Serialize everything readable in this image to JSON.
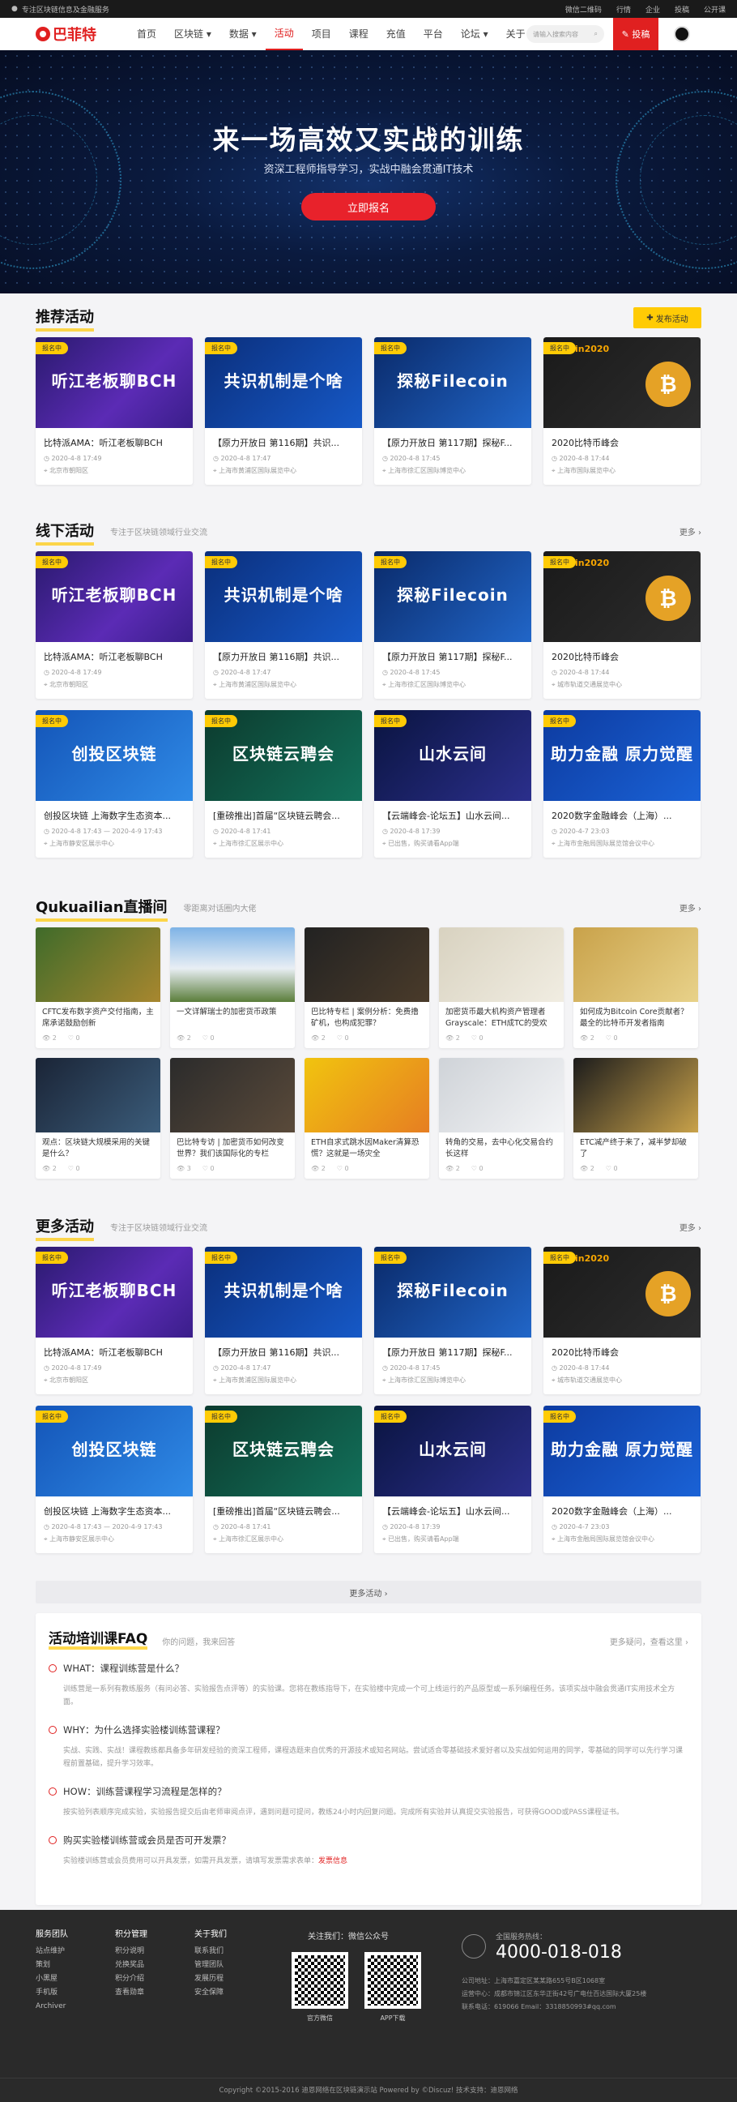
{
  "topbar": {
    "left": "专注区块链信息及金融服务",
    "links": [
      "微信二维码",
      "行情",
      "企业",
      "投稿",
      "公开课"
    ]
  },
  "nav": {
    "logo": "巴菲特",
    "menu": [
      "首页",
      "区块链 ▾",
      "数据 ▾",
      "活动",
      "项目",
      "课程",
      "充值",
      "平台",
      "论坛 ▾",
      "关于"
    ],
    "search_placeholder": "请输入搜索内容",
    "contribute": "投稿"
  },
  "hero": {
    "title": "来一场高效又实战的训练",
    "subtitle": "资深工程师指导学习，实战中融会贯通IT技术",
    "button": "立即报名"
  },
  "recommend": {
    "title": "推荐活动",
    "publish": "发布活动",
    "cards": [
      {
        "badge": "报名中",
        "img": "听江老板聊BCH",
        "title": "比特派AMA：听江老板聊BCH",
        "date": "2020-4-8 17:49",
        "place": "北京市朝阳区"
      },
      {
        "badge": "报名中",
        "img": "共识机制是个啥",
        "title": "【原力开放日 第116期】共识...",
        "date": "2020-4-8 17:47",
        "place": "上海市黄浦区国际展览中心"
      },
      {
        "badge": "报名中",
        "img": "探秘Filecoin",
        "title": "【原力开放日 第117期】探秘F...",
        "date": "2020-4-8 17:45",
        "place": "上海市徐汇区国际博览中心"
      },
      {
        "badge": "报名中",
        "img": "bitcoin2020",
        "title": "2020比特币峰会",
        "date": "2020-4-8 17:44",
        "place": "上海市国际展览中心"
      }
    ]
  },
  "offline": {
    "title": "线下活动",
    "sub": "专注于区块链领域行业交流",
    "more": "更多 ›",
    "row1": [
      {
        "badge": "报名中",
        "img": "听江老板聊BCH",
        "title": "比特派AMA：听江老板聊BCH",
        "date": "2020-4-8 17:49",
        "place": "北京市朝阳区"
      },
      {
        "badge": "报名中",
        "img": "共识机制是个啥",
        "title": "【原力开放日 第116期】共识...",
        "date": "2020-4-8 17:47",
        "place": "上海市黄浦区国际展览中心"
      },
      {
        "badge": "报名中",
        "img": "探秘Filecoin",
        "title": "【原力开放日 第117期】探秘F...",
        "date": "2020-4-8 17:45",
        "place": "上海市徐汇区国际博览中心"
      },
      {
        "badge": "报名中",
        "img": "bitcoin2020",
        "title": "2020比特币峰会",
        "date": "2020-4-8 17:44",
        "place": "城市轨道交通展览中心"
      }
    ],
    "row2": [
      {
        "badge": "报名中",
        "img": "创投区块链",
        "title": "创投区块链 上海数字生态资本...",
        "date": "2020-4-8 17:43 — 2020-4-9 17:43",
        "place": "上海市静安区展示中心"
      },
      {
        "badge": "报名中",
        "img": "区块链云聘会",
        "title": "[重磅推出]首届“区块链云聘会...",
        "date": "2020-4-8 17:41",
        "place": "上海市徐汇区展示中心"
      },
      {
        "badge": "报名中",
        "img": "山水云间",
        "title": "【云端峰会-论坛五】山水云间...",
        "date": "2020-4-8 17:39",
        "place": "已出售，购买请看App端"
      },
      {
        "badge": "报名中",
        "img": "助力金融 原力觉醒",
        "title": "2020数字金融峰会（上海）...",
        "date": "2020-4-7 23:03",
        "place": "上海市金融局国际展览馆会议中心"
      }
    ]
  },
  "live": {
    "title": "Qukuailian直播间",
    "sub": "零距离对话圈内大佬",
    "more": "更多 ›",
    "items": [
      {
        "title": "CFTC发布数字资产交付指南，主席承诺鼓励创新",
        "views": "2",
        "likes": "0"
      },
      {
        "title": "一文详解瑞士的加密货币政策",
        "views": "2",
        "likes": "0"
      },
      {
        "title": "巴比特专栏 | 案例分析：免费撸矿机，也构成犯罪？",
        "views": "2",
        "likes": "0"
      },
      {
        "title": "加密货币最大机构资产管理者Grayscale：ETH成TC的受欢",
        "views": "2",
        "likes": "0"
      },
      {
        "title": "如何成为Bitcoin Core贡献者？最全的比特币开发者指南",
        "views": "2",
        "likes": "0"
      },
      {
        "title": "观点：区块链大规模采用的关键是什么？",
        "views": "2",
        "likes": "0"
      },
      {
        "title": "巴比特专访 | 加密货币如何改变世界？我们该国际化的专栏",
        "views": "3",
        "likes": "0"
      },
      {
        "title": "ETH自求式跳水因Maker清算恐慌？这就是一场灾全",
        "views": "2",
        "likes": "0"
      },
      {
        "title": "转角的交易，去中心化交易合约长这样",
        "views": "2",
        "likes": "0"
      },
      {
        "title": "ETC减产终于来了，减半梦却破了",
        "views": "2",
        "likes": "0"
      }
    ]
  },
  "more_events": {
    "title": "更多活动",
    "sub": "专注于区块链领域行业交流",
    "more": "更多 ›"
  },
  "more_bar": "更多活动 ›",
  "faq": {
    "title": "活动培训课FAQ",
    "sub": "你的问题，我来回答",
    "right": "更多疑问，查看这里 ›",
    "items": [
      {
        "q": "WHAT：课程训练营是什么？",
        "a": "训练营是一系列有教练服务（有问必答、实验报告点评等）的实验课。您将在教练指导下，在实验楼中完成一个可上线运行的产品原型或一系列编程任务。该项实战中融会贯通IT实用技术全方面。"
      },
      {
        "q": "WHY：为什么选择实验楼训练营课程？",
        "a": "实战、实践、实战！课程教练都具备多年研发经验的资深工程师，课程选题来自优秀的开源技术或知名网站。尝试适合零基础技术爱好者以及实战如何运用的同学，零基础的同学可以先行学习课程前置基础，提升学习效率。"
      },
      {
        "q": "HOW：训练营课程学习流程是怎样的？",
        "a": "按实验列表顺序完成实验，实验报告提交后由老师审阅点评，遇到问题可提问，教练24小时内回复问题。完成所有实验并认真提交实验报告，可获得GOOD或PASS课程证书。"
      },
      {
        "q": "购买实验楼训练营或会员是否可开发票？",
        "a": "实验楼训练营或会员费用可以开具发票，如需开具发票，请填写发票需求表单：",
        "link": "发票信息"
      }
    ]
  },
  "footer": {
    "cols": [
      {
        "h": "服务团队",
        "items": [
          "站点维护",
          "策划",
          "小黑屋",
          "手机版",
          "Archiver"
        ]
      },
      {
        "h": "积分管理",
        "items": [
          "积分说明",
          "兑换奖品",
          "积分介绍",
          "查看勋章"
        ]
      },
      {
        "h": "关于我们",
        "items": [
          "联系我们",
          "管理团队",
          "发展历程",
          "安全保障"
        ]
      }
    ],
    "follow": "关注我们：微信公众号",
    "qr1": "官方微信",
    "qr2": "APP下载",
    "phone_label": "全国服务热线：",
    "phone": "4000-018-018",
    "addr": [
      "公司地址：上海市嘉定区某某路655号B区1068室",
      "运营中心：成都市锦江区东华正街42号广电仕百达国际大厦25楼",
      "联系电话：619066 Email：3318850993#qq.com"
    ],
    "copyright": "Copyright  ©2015-2016  迪恩网络在区块链演示站  Powered by ©Discuz!  技术支持：迪恩网络"
  }
}
